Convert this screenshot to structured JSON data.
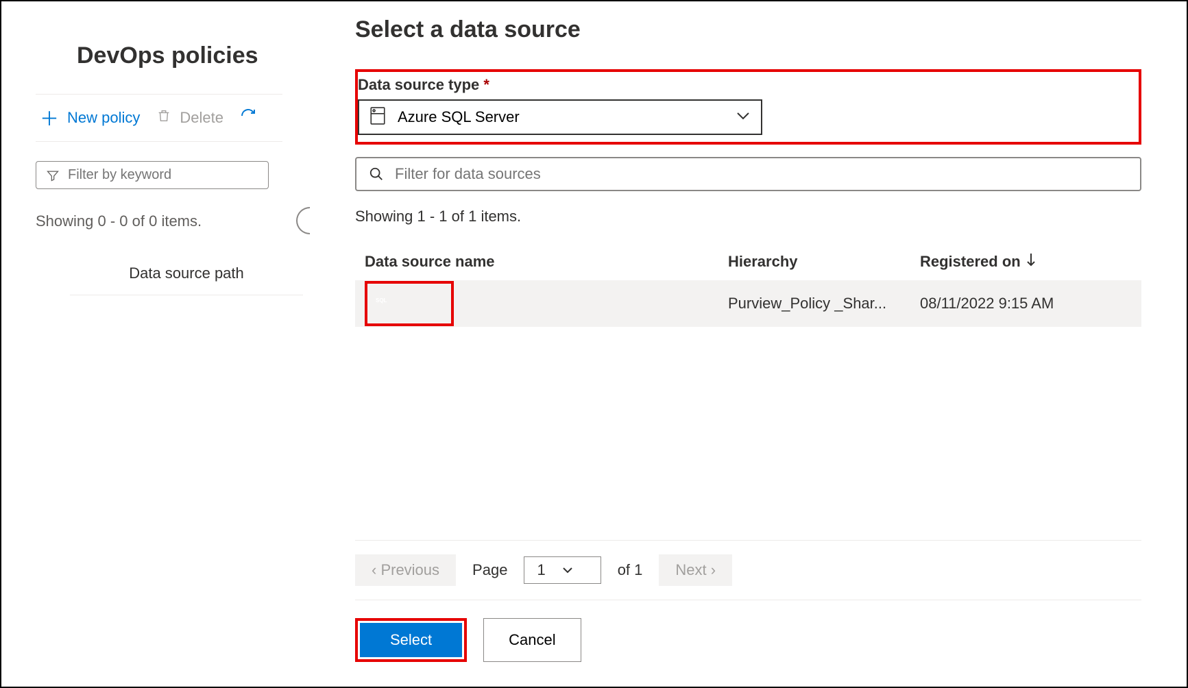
{
  "left": {
    "title": "DevOps policies",
    "toolbar": {
      "new_label": "New policy",
      "delete_label": "Delete"
    },
    "filter_placeholder": "Filter by keyword",
    "showing_text": "Showing 0 - 0 of 0 items.",
    "column_header": "Data source path"
  },
  "panel": {
    "title": "Select a data source",
    "type_field": {
      "label": "Data source type",
      "value": "Azure SQL Server"
    },
    "search_placeholder": "Filter for data sources",
    "showing_text": "Showing 1 - 1 of 1 items.",
    "columns": {
      "name": "Data source name",
      "hierarchy": "Hierarchy",
      "registered": "Registered on"
    },
    "rows": [
      {
        "name": "",
        "hierarchy": "Purview_Policy _Shar...",
        "registered": "08/11/2022 9:15 AM"
      }
    ],
    "pager": {
      "prev": "‹ Previous",
      "page_label": "Page",
      "page_value": "1",
      "of_text": "of 1",
      "next": "Next ›"
    },
    "buttons": {
      "select": "Select",
      "cancel": "Cancel"
    }
  }
}
